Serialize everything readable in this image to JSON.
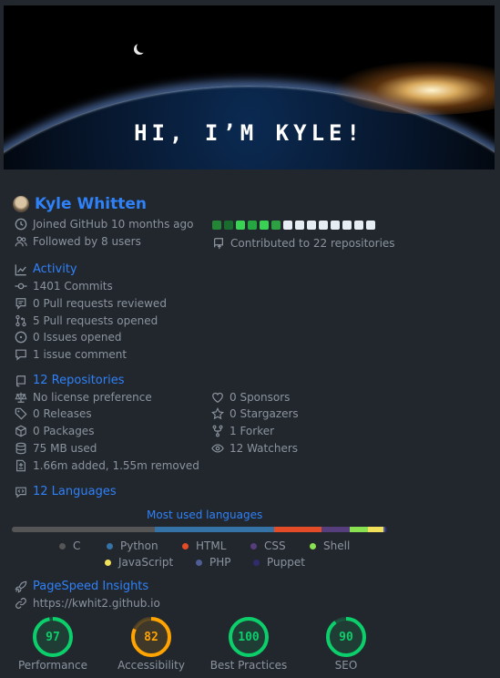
{
  "hero": {
    "title": "HI, I’M KYLE!"
  },
  "profile": {
    "name": "Kyle Whitten",
    "joined": "Joined GitHub 10 months ago",
    "followed": "Followed by 8 users",
    "contributed": "Contributed to 22 repositories",
    "calendar": [
      "#238636",
      "#196c2e",
      "#39d353",
      "#26a641",
      "#39d353",
      "#2ea043",
      "#e6edf3",
      "#e6edf3",
      "#e6edf3",
      "#e6edf3",
      "#e6edf3",
      "#e6edf3",
      "#e6edf3",
      "#e6edf3"
    ]
  },
  "activity": {
    "title": "Activity",
    "commits": "1401 Commits",
    "prs_reviewed": "0 Pull requests reviewed",
    "prs_opened": "5 Pull requests opened",
    "issues_opened": "0 Issues opened",
    "issue_comment": "1 issue comment"
  },
  "repos": {
    "title": "12 Repositories",
    "license": "No license preference",
    "releases": "0 Releases",
    "packages": "0 Packages",
    "used": "75 MB used",
    "lines": "1.66m added, 1.55m removed",
    "sponsors": "0 Sponsors",
    "stargazers": "0 Stargazers",
    "forker": "1 Forker",
    "watchers": "12 Watchers"
  },
  "languages": {
    "title": "12 Languages",
    "caption": "Most used languages",
    "items": [
      {
        "name": "C",
        "color": "#555555",
        "share": 38
      },
      {
        "name": "Python",
        "color": "#3572a5",
        "share": 32
      },
      {
        "name": "HTML",
        "color": "#e34c26",
        "share": 12.5
      },
      {
        "name": "CSS",
        "color": "#563d7c",
        "share": 7.5
      },
      {
        "name": "Shell",
        "color": "#89e051",
        "share": 5
      },
      {
        "name": "JavaScript",
        "color": "#f1e05a",
        "share": 4
      },
      {
        "name": "PHP",
        "color": "#4f5d95",
        "share": 0.5
      },
      {
        "name": "Puppet",
        "color": "#302b6d",
        "share": 0.5
      }
    ]
  },
  "pagespeed": {
    "title": "PageSpeed Insights",
    "url": "https://kwhit2.github.io",
    "scores": [
      {
        "label": "Performance",
        "value": "97",
        "color": "#0cce6b"
      },
      {
        "label": "Accessibility",
        "value": "82",
        "color": "#ffa400"
      },
      {
        "label": "Best Practices",
        "value": "100",
        "color": "#0cce6b"
      },
      {
        "label": "SEO",
        "value": "90",
        "color": "#0cce6b"
      }
    ]
  }
}
